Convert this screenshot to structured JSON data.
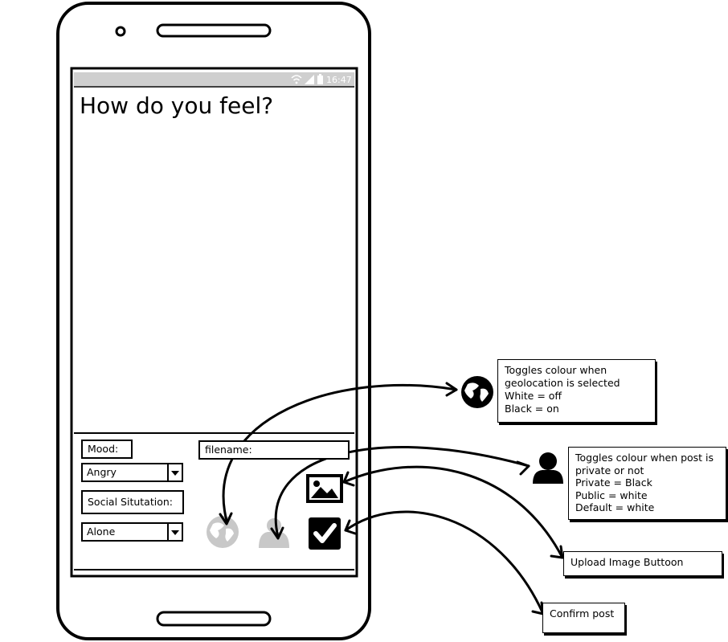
{
  "status_bar": {
    "time": "16:47"
  },
  "screen": {
    "title": "How do you feel?"
  },
  "form": {
    "mood_label": "Mood:",
    "mood_value": "Angry",
    "social_label": "Social Situtation:",
    "social_value": "Alone",
    "filename_label": "filename:"
  },
  "icons": {
    "geolocation": "globe-icon",
    "privacy": "user-icon",
    "upload": "image-icon",
    "confirm": "checkmark-icon",
    "wifi": "wifi-icon",
    "signal": "signal-icon",
    "battery": "battery-icon"
  },
  "annotations": {
    "geolocation": [
      "Toggles colour when",
      "geolocation is selected",
      "White = off",
      "Black = on"
    ],
    "privacy": [
      "Toggles colour when post is",
      "private or not",
      "Private = Black",
      "Public = white",
      "Default = white"
    ],
    "upload": "Upload Image Buttoon",
    "confirm": "Confirm post"
  },
  "colors": {
    "inactive_icon": "#c8c8c8",
    "status_bar": "#cfcfcf",
    "ink": "#000000"
  }
}
